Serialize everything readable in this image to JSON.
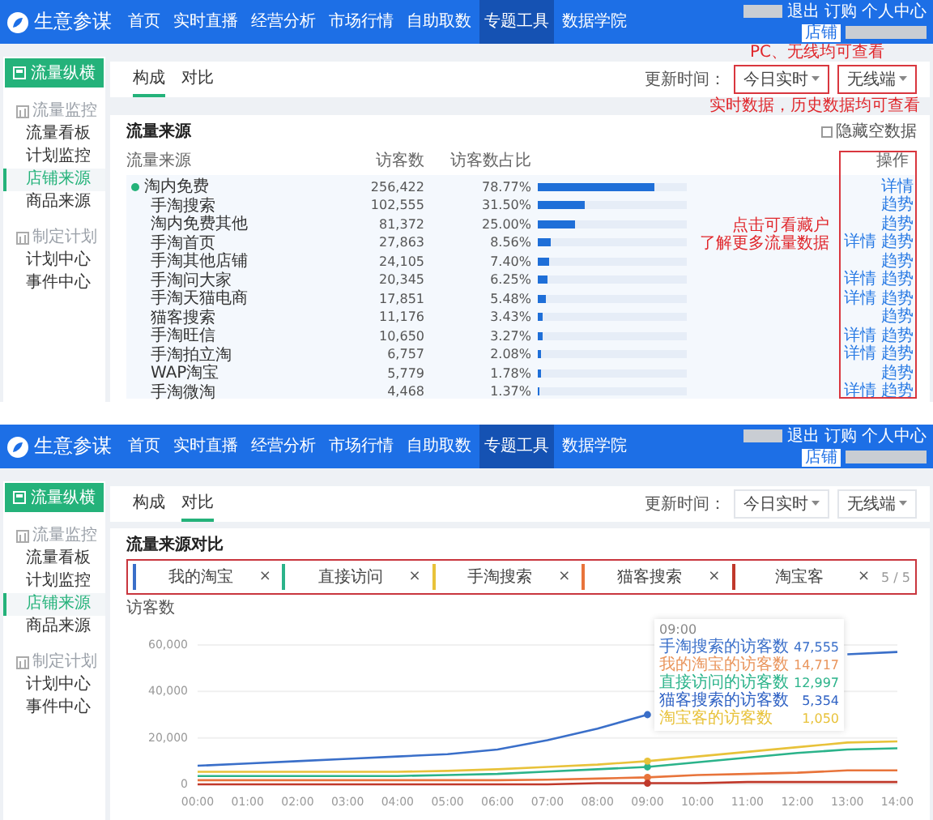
{
  "views": [
    {
      "kind": "composition",
      "logo": "生意参谋",
      "nav": [
        {
          "label": "首页",
          "selected": false
        },
        {
          "label": "实时直播",
          "selected": false
        },
        {
          "label": "经营分析",
          "selected": false
        },
        {
          "label": "市场行情",
          "selected": false
        },
        {
          "label": "自助取数",
          "selected": false
        },
        {
          "label": "专题工具",
          "selected": true
        },
        {
          "label": "数据学院",
          "selected": false
        }
      ],
      "user_links": [
        "退出",
        "订购",
        "个人中心"
      ],
      "shop_badge": "店铺",
      "sidebar": {
        "main_button": "流量纵横",
        "sections": [
          {
            "title": "流量监控",
            "items": [
              {
                "label": "流量看板",
                "selected": false
              },
              {
                "label": "计划监控",
                "selected": false
              },
              {
                "label": "店铺来源",
                "selected": true
              },
              {
                "label": "商品来源",
                "selected": false
              }
            ]
          },
          {
            "title": "制定计划",
            "items": [
              {
                "label": "计划中心",
                "selected": false
              },
              {
                "label": "事件中心",
                "selected": false
              }
            ]
          }
        ]
      },
      "tabs": [
        {
          "label": "构成",
          "selected": true
        },
        {
          "label": "对比",
          "selected": false
        }
      ],
      "update_label": "更新时间：",
      "dropdowns": [
        {
          "label": "今日实时",
          "highlighted": true
        },
        {
          "label": "无线端",
          "highlighted": true
        }
      ],
      "annotations": [
        "PC、无线均可查看",
        "实时数据，历史数据均可查看"
      ],
      "card": {
        "title": "流量来源",
        "hide_empty": {
          "label": "隐藏空数据",
          "checked": false
        },
        "columns": [
          "流量来源",
          "访客数",
          "访客数占比",
          "操作"
        ],
        "actions_highlighted": true,
        "note": [
          "点击可看藏户",
          "了解更多流量数据"
        ],
        "rows": [
          {
            "name": "淘内免费",
            "visitors": "256,422",
            "share": "78.77%",
            "level": 0.7877,
            "actions": [
              "详情"
            ],
            "expanded": true,
            "children": [
              {
                "name": "手淘搜索",
                "visitors": "102,555",
                "share": "31.50%",
                "level": 0.315,
                "actions": [
                  "趋势"
                ]
              },
              {
                "name": "淘内免费其他",
                "visitors": "81,372",
                "share": "25.00%",
                "level": 0.25,
                "actions": [
                  "趋势"
                ]
              },
              {
                "name": "手淘首页",
                "visitors": "27,863",
                "share": "8.56%",
                "level": 0.0856,
                "actions": [
                  "详情",
                  "趋势"
                ]
              },
              {
                "name": "手淘其他店铺",
                "visitors": "24,105",
                "share": "7.40%",
                "level": 0.074,
                "actions": [
                  "趋势"
                ]
              },
              {
                "name": "手淘问大家",
                "visitors": "20,345",
                "share": "6.25%",
                "level": 0.0625,
                "actions": [
                  "详情",
                  "趋势"
                ]
              },
              {
                "name": "手淘天猫电商",
                "visitors": "17,851",
                "share": "5.48%",
                "level": 0.0548,
                "actions": [
                  "详情",
                  "趋势"
                ]
              },
              {
                "name": "猫客搜索",
                "visitors": "11,176",
                "share": "3.43%",
                "level": 0.0343,
                "actions": [
                  "趋势"
                ]
              },
              {
                "name": "手淘旺信",
                "visitors": "10,650",
                "share": "3.27%",
                "level": 0.0327,
                "actions": [
                  "详情",
                  "趋势"
                ]
              },
              {
                "name": "手淘拍立淘",
                "visitors": "6,757",
                "share": "2.08%",
                "level": 0.0208,
                "actions": [
                  "详情",
                  "趋势"
                ]
              },
              {
                "name": "WAP淘宝",
                "visitors": "5,779",
                "share": "1.78%",
                "level": 0.0178,
                "actions": [
                  "趋势"
                ]
              },
              {
                "name": "手淘微淘",
                "visitors": "4,468",
                "share": "1.37%",
                "level": 0.0137,
                "actions": [
                  "详情",
                  "趋势"
                ]
              }
            ]
          }
        ]
      }
    },
    {
      "kind": "comparison",
      "logo": "生意参谋",
      "nav": [
        {
          "label": "首页",
          "selected": false
        },
        {
          "label": "实时直播",
          "selected": false
        },
        {
          "label": "经营分析",
          "selected": false
        },
        {
          "label": "市场行情",
          "selected": false
        },
        {
          "label": "自助取数",
          "selected": false
        },
        {
          "label": "专题工具",
          "selected": true
        },
        {
          "label": "数据学院",
          "selected": false
        }
      ],
      "user_links": [
        "退出",
        "订购",
        "个人中心"
      ],
      "shop_badge": "店铺",
      "sidebar": {
        "main_button": "流量纵横",
        "sections": [
          {
            "title": "流量监控",
            "items": [
              {
                "label": "流量看板",
                "selected": false
              },
              {
                "label": "计划监控",
                "selected": false
              },
              {
                "label": "店铺来源",
                "selected": true
              },
              {
                "label": "商品来源",
                "selected": false
              }
            ]
          },
          {
            "title": "制定计划",
            "items": [
              {
                "label": "计划中心",
                "selected": false
              },
              {
                "label": "事件中心",
                "selected": false
              }
            ]
          }
        ]
      },
      "tabs": [
        {
          "label": "构成",
          "selected": false
        },
        {
          "label": "对比",
          "selected": true
        }
      ],
      "update_label": "更新时间：",
      "dropdowns": [
        {
          "label": "今日实时",
          "highlighted": false
        },
        {
          "label": "无线端",
          "highlighted": false
        }
      ],
      "card": {
        "title": "流量来源对比",
        "chips_highlighted": true,
        "remove_mark": "×",
        "chip_count": "5 / 5",
        "chart_data": {
          "type": "line",
          "ylabel": "访客数",
          "ylim": [
            0,
            60000
          ],
          "x": [
            "00:00",
            "01:00",
            "02:00",
            "03:00",
            "04:00",
            "05:00",
            "06:00",
            "07:00",
            "08:00",
            "09:00",
            "10:00",
            "11:00",
            "12:00",
            "13:00",
            "14:00"
          ],
          "yticks": [
            {
              "value": 0,
              "label": "0"
            },
            {
              "value": 20000,
              "label": "20,000"
            },
            {
              "value": 40000,
              "label": "40,000"
            },
            {
              "value": 60000,
              "label": "60,000"
            }
          ],
          "series": [
            {
              "name": "我的淘宝",
              "color": "#3a6fc9",
              "values": [
                8000,
                9000,
                10000,
                11000,
                12000,
                13000,
                15000,
                19000,
                24000,
                30000,
                null,
                null,
                null,
                56000,
                57000
              ]
            },
            {
              "name": "直接访问",
              "color": "#2bb38a",
              "values": [
                3600,
                3600,
                3600,
                3600,
                3600,
                4000,
                4500,
                5500,
                6500,
                7500,
                9500,
                11500,
                13500,
                15000,
                15500
              ]
            },
            {
              "name": "手淘搜索",
              "color": "#e8c23a",
              "values": [
                5400,
                5400,
                5400,
                5400,
                5400,
                5800,
                6500,
                7500,
                8500,
                10000,
                12000,
                14000,
                16000,
                18000,
                18500
              ]
            },
            {
              "name": "猫客搜索",
              "color": "#e8743b",
              "values": [
                1800,
                1800,
                1800,
                1800,
                1800,
                1800,
                1800,
                2000,
                2500,
                3000,
                4000,
                4500,
                5000,
                6000,
                6000
              ]
            },
            {
              "name": "淘宝客",
              "color": "#c0392b",
              "values": [
                0,
                0,
                0,
                0,
                0,
                0,
                0,
                0,
                500,
                500,
                500,
                1000,
                1000,
                1000,
                1000
              ]
            }
          ]
        },
        "tooltip": {
          "title": "09:00",
          "entries": [
            {
              "label": "手淘搜索的访客数",
              "value": "47,555",
              "color": "#3a6fc9"
            },
            {
              "label": "我的淘宝的访客数",
              "value": "14,717",
              "color": "#e9955c"
            },
            {
              "label": "直接访问的访客数",
              "value": "12,997",
              "color": "#2bb38a"
            },
            {
              "label": "猫客搜索的访客数",
              "value": "5,354",
              "color": "#2f62c4"
            },
            {
              "label": "淘宝客的访客数",
              "value": "1,050",
              "color": "#e8c23a"
            }
          ]
        }
      }
    }
  ]
}
